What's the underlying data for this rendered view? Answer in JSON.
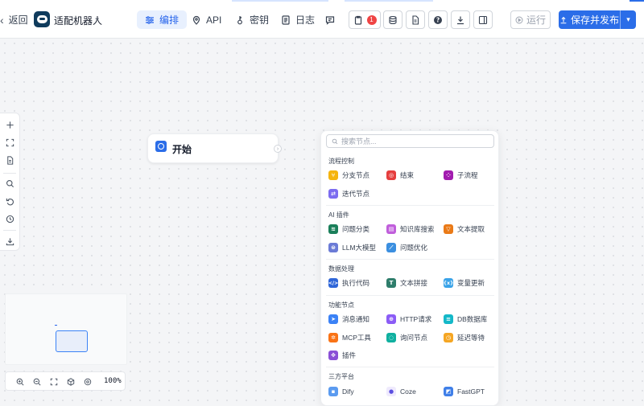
{
  "header": {
    "back_label": "返回",
    "app_name": "适配机器人",
    "nav_tabs": [
      {
        "label": "编排",
        "icon": "sliders-icon",
        "active": true
      },
      {
        "label": "API",
        "icon": "map-pin-icon",
        "active": false
      },
      {
        "label": "密钥",
        "icon": "key-icon",
        "active": false
      },
      {
        "label": "日志",
        "icon": "log-file-icon",
        "active": false
      }
    ],
    "toolbar_icons": [
      "chat-icon",
      "clipboard-icon",
      "database-icon",
      "document-icon",
      "help-icon",
      "download-icon",
      "panel-icon"
    ],
    "notification_count": "1",
    "run_label": "运行",
    "publish_label": "保存并发布"
  },
  "left_toolbar": [
    "plus-icon",
    "fit-view-icon",
    "note-icon",
    "search-icon",
    "undo-icon",
    "history-icon",
    "export-icon"
  ],
  "canvas": {
    "start_node": {
      "label": "开始"
    }
  },
  "palette": {
    "search_placeholder": "搜索节点...",
    "groups": [
      {
        "title": "流程控制",
        "items": [
          {
            "label": "分支节点",
            "icon": "branch-icon",
            "color": "#f5b40f"
          },
          {
            "label": "结束",
            "icon": "stop-icon",
            "color": "#e53e3e"
          },
          {
            "label": "子流程",
            "icon": "subflow-icon",
            "color": "#a21caf"
          },
          {
            "label": "迭代节点",
            "icon": "loop-icon",
            "color": "#7c6cf0"
          }
        ]
      },
      {
        "title": "AI 插件",
        "items": [
          {
            "label": "问题分类",
            "icon": "layers-icon",
            "color": "#1a7f5a"
          },
          {
            "label": "知识库搜索",
            "icon": "knowledge-icon",
            "color": "#c05edb"
          },
          {
            "label": "文本提取",
            "icon": "filter-icon",
            "color": "#ea7a17"
          },
          {
            "label": "LLM大模型",
            "icon": "llm-icon",
            "color": "#6b7bd6"
          },
          {
            "label": "问题优化",
            "icon": "wand-icon",
            "color": "#3b8fe0"
          }
        ]
      },
      {
        "title": "数据处理",
        "items": [
          {
            "label": "执行代码",
            "icon": "code-icon",
            "color": "#2f66d8"
          },
          {
            "label": "文本拼接",
            "icon": "text-icon",
            "color": "#2e7d6b"
          },
          {
            "label": "变量更新",
            "icon": "variable-icon",
            "color": "#3aa3e8"
          }
        ]
      },
      {
        "title": "功能节点",
        "items": [
          {
            "label": "消息通知",
            "icon": "send-icon",
            "color": "#3b82f6"
          },
          {
            "label": "HTTP请求",
            "icon": "globe-icon",
            "color": "#8b5cf6"
          },
          {
            "label": "DB数据库",
            "icon": "db-icon",
            "color": "#14b8c8"
          },
          {
            "label": "MCP工具",
            "icon": "mcp-icon",
            "color": "#f97316"
          },
          {
            "label": "询问节点",
            "icon": "ask-icon",
            "color": "#10b0a0"
          },
          {
            "label": "延迟等待",
            "icon": "clock-icon",
            "color": "#f5a623"
          },
          {
            "label": "插件",
            "icon": "plugin-icon",
            "color": "#8a4fd6"
          }
        ]
      },
      {
        "title": "三方平台",
        "items": [
          {
            "label": "Dify",
            "icon": "dify-icon",
            "color": "#5b9bf0"
          },
          {
            "label": "Coze",
            "icon": "coze-icon",
            "color": "#5b4fe0"
          },
          {
            "label": "FastGPT",
            "icon": "fastgpt-icon",
            "color": "#3f7fe8"
          }
        ]
      }
    ]
  },
  "zoom": {
    "level": "100%"
  },
  "colors": {
    "primary": "#2b6de8",
    "active_tab_bg": "#e8f0fe",
    "badge": "#ef4444"
  }
}
